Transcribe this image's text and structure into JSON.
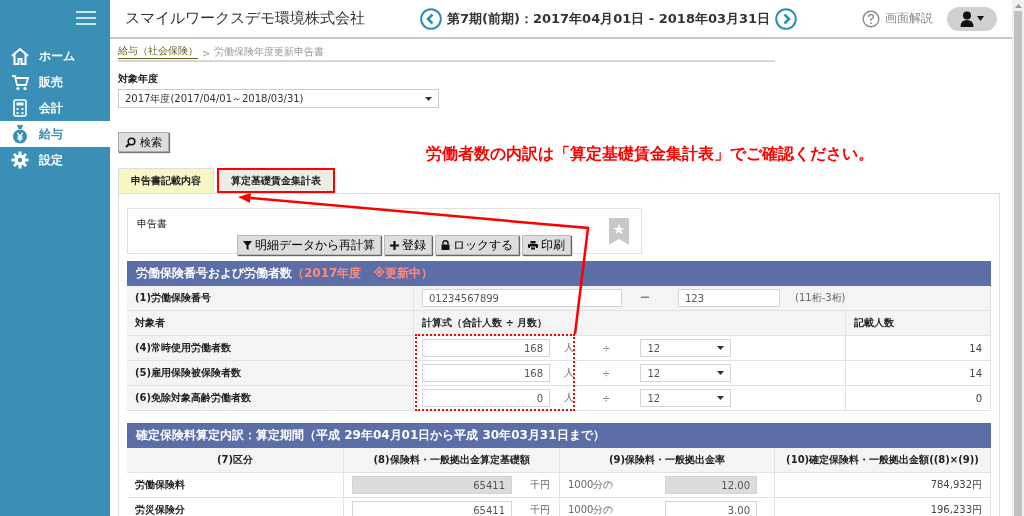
{
  "sidebar": {
    "items": [
      {
        "label": "ホーム",
        "selected": false
      },
      {
        "label": "販売",
        "selected": false
      },
      {
        "label": "会計",
        "selected": false
      },
      {
        "label": "給与",
        "selected": true
      },
      {
        "label": "設定",
        "selected": false
      }
    ]
  },
  "header": {
    "company": "スマイルワークスデモ環境株式会社",
    "period": "第7期(前期)：2017年04月01日 - 2018年03月31日",
    "help": "画面解説"
  },
  "breadcrumb": {
    "link": "給与（社会保険）",
    "separator": ">",
    "current": "労働保険年度更新申告書"
  },
  "year_field": {
    "label": "対象年度",
    "value": "2017年度(2017/04/01～2018/03/31)"
  },
  "search_button": "検索",
  "note": "労働者数の内訳は「算定基礎賃金集計表」でご確認ください。",
  "tabs": [
    {
      "label": "申告書記載内容",
      "selected": true,
      "highlighted": false
    },
    {
      "label": "算定基礎賃金集計表",
      "selected": false,
      "highlighted": true
    }
  ],
  "form_card": {
    "title": "申告書",
    "buttons": [
      {
        "label": "明細データから再計算"
      },
      {
        "label": "登録"
      },
      {
        "label": "ロックする"
      },
      {
        "label": "印刷"
      }
    ]
  },
  "section1": {
    "title": "労働保険番号および労働者数",
    "status": "（2017年度　※更新中）",
    "insurance_number": {
      "label": "(1)労働保険番号",
      "value_1": "01234567899",
      "dash": "ー",
      "value_2": "123",
      "hint": "(11桁-3桁)"
    },
    "columns": [
      "対象者",
      "計算式（合計人数 ÷ 月数）",
      "記載人数"
    ],
    "rows": [
      {
        "label": "(4)常時使用労働者数",
        "total": "168",
        "unit": "人",
        "divide": "÷",
        "months": "12",
        "count": "14"
      },
      {
        "label": "(5)雇用保険被保険者数",
        "total": "168",
        "unit": "人",
        "divide": "÷",
        "months": "12",
        "count": "14"
      },
      {
        "label": "(6)免除対象高齢労働者数",
        "total": "0",
        "unit": "人",
        "divide": "÷",
        "months": "12",
        "count": "0"
      }
    ]
  },
  "section2": {
    "title": "確定保険料算定内訳：算定期間（平成 29年04月01日から平成 30年03月31日まで）",
    "columns": [
      "(7)区分",
      "(8)保険料・一般拠出金算定基礎額",
      "(9)保険料・一般拠出金率",
      "(10)確定保険料・一般拠出金額((8)×(9))"
    ],
    "rows": [
      {
        "label": "労働保険料",
        "base": "65411",
        "base_unit": "千円",
        "rate_prefix": "1000分の",
        "rate": "12.00",
        "amount": "784,932円",
        "disabled": true
      },
      {
        "label": "労災保険分",
        "base": "65411",
        "base_unit": "千円",
        "rate_prefix": "1000分の",
        "rate": "3.00",
        "amount": "196,233円",
        "disabled": false
      }
    ]
  }
}
